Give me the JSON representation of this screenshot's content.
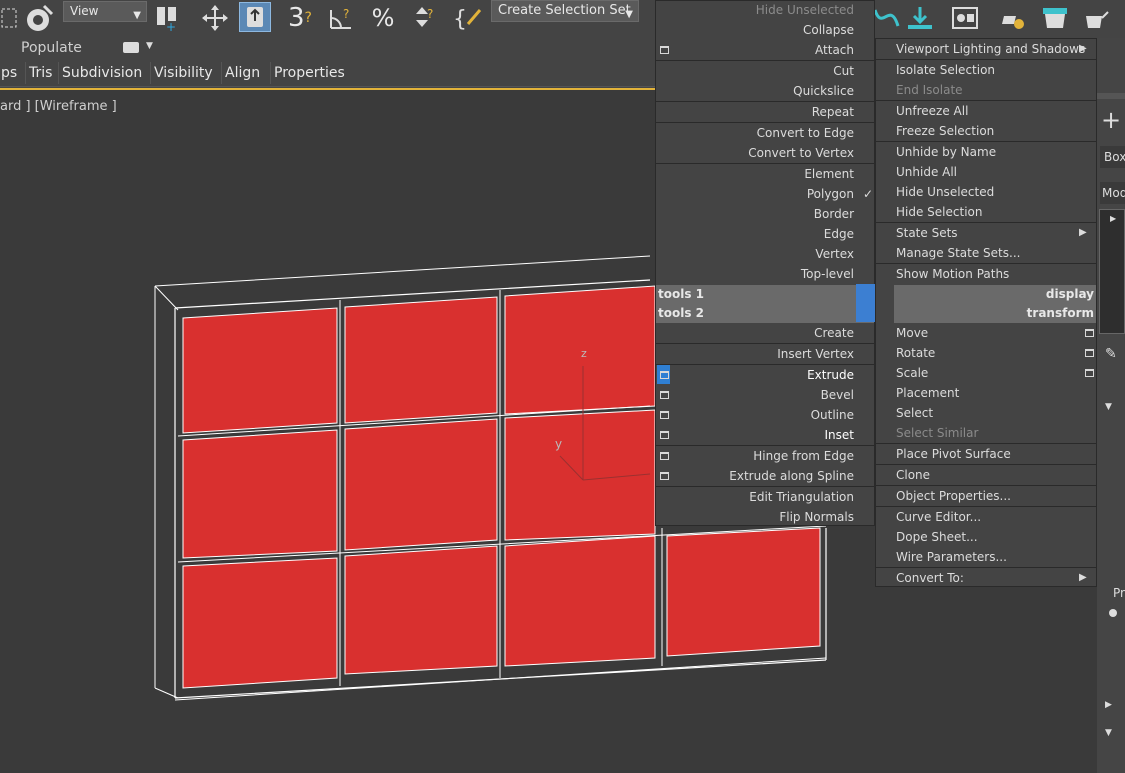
{
  "toolbar": {
    "view_dropdown": "View",
    "selection_set_dropdown": "Create Selection Set",
    "snap_label": "3",
    "angle_label": "∠",
    "percent_label": "%"
  },
  "ribbon": {
    "populate_label": "Populate",
    "tabs": [
      "ps",
      "Tris",
      "Subdivision",
      "Visibility",
      "Align",
      "Properties"
    ]
  },
  "viewport": {
    "label": "ard ] [Wireframe ]",
    "axis_z": "z",
    "axis_y": "y",
    "grid_color": "#d9302f"
  },
  "quad_left_top": {
    "items": [
      "Hide Unselected",
      "Collapse",
      "Attach",
      "Cut",
      "Quickslice",
      "Repeat",
      "Convert to Edge",
      "Convert to Vertex",
      "Element",
      "Polygon",
      "Border",
      "Edge",
      "Vertex",
      "Top-level"
    ],
    "header": "tools 1"
  },
  "quad_left_bottom": {
    "header": "tools 2",
    "items": [
      "Create",
      "Insert Vertex",
      "Extrude",
      "Bevel",
      "Outline",
      "Inset",
      "Hinge from Edge",
      "Extrude along Spline",
      "Edit Triangulation",
      "Flip Normals"
    ]
  },
  "quad_right_top": {
    "items": [
      "Viewport Lighting and Shadows",
      "Isolate Selection",
      "End Isolate",
      "Unfreeze All",
      "Freeze Selection",
      "Unhide by Name",
      "Unhide All",
      "Hide Unselected",
      "Hide Selection",
      "State Sets",
      "Manage State Sets...",
      "Show Motion Paths"
    ],
    "header": "display"
  },
  "quad_right_bottom": {
    "header": "transform",
    "items": [
      "Move",
      "Rotate",
      "Scale",
      "Placement",
      "Select",
      "Select Similar",
      "Place Pivot Surface",
      "Clone",
      "Object Properties...",
      "Curve Editor...",
      "Dope Sheet...",
      "Wire Parameters...",
      "Convert To:"
    ]
  },
  "cmd_panel": {
    "box_label": "Box",
    "mod_label": "Mod",
    "pr_label": "Pr"
  }
}
